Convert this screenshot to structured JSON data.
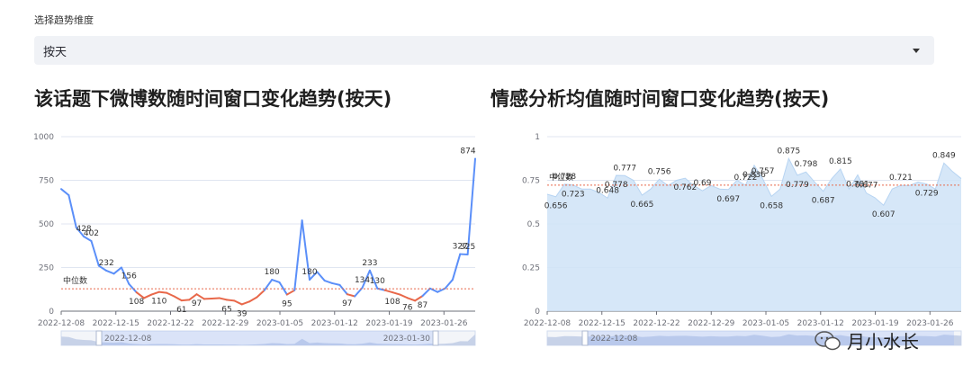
{
  "selector": {
    "label": "选择趋势维度",
    "value": "按天"
  },
  "watermark": "月小水长",
  "colors": {
    "blue": "#5b8ff9",
    "red": "#e8684a",
    "area": "#cfe3f7",
    "median": "#e8684a"
  },
  "chart_data": [
    {
      "type": "line",
      "title": "该话题下微博数随时间窗口变化趋势(按天)",
      "xlabel": "",
      "ylabel": "",
      "ylim": [
        0,
        1000
      ],
      "yticks": [
        "0",
        "250",
        "500",
        "750",
        "1000"
      ],
      "xticks": [
        "2022-12-08",
        "2022-12-15",
        "2022-12-22",
        "2022-12-29",
        "2023-01-05",
        "2023-01-12",
        "2023-01-19",
        "2023-01-26"
      ],
      "median_label": "中位数",
      "median": 128,
      "dataZoom": {
        "start": "2022-12-08",
        "end": "2023-01-30"
      },
      "x": [
        "2022-12-08",
        "2022-12-09",
        "2022-12-10",
        "2022-12-11",
        "2022-12-12",
        "2022-12-13",
        "2022-12-14",
        "2022-12-15",
        "2022-12-16",
        "2022-12-17",
        "2022-12-18",
        "2022-12-19",
        "2022-12-20",
        "2022-12-21",
        "2022-12-22",
        "2022-12-23",
        "2022-12-24",
        "2022-12-25",
        "2022-12-26",
        "2022-12-27",
        "2022-12-28",
        "2022-12-29",
        "2022-12-30",
        "2022-12-31",
        "2023-01-01",
        "2023-01-02",
        "2023-01-03",
        "2023-01-04",
        "2023-01-05",
        "2023-01-06",
        "2023-01-07",
        "2023-01-08",
        "2023-01-09",
        "2023-01-10",
        "2023-01-11",
        "2023-01-12",
        "2023-01-13",
        "2023-01-14",
        "2023-01-15",
        "2023-01-16",
        "2023-01-17",
        "2023-01-18",
        "2023-01-19",
        "2023-01-20",
        "2023-01-21",
        "2023-01-22",
        "2023-01-23",
        "2023-01-24",
        "2023-01-25",
        "2023-01-26",
        "2023-01-27",
        "2023-01-28",
        "2023-01-29",
        "2023-01-30"
      ],
      "values": [
        700,
        665,
        480,
        428,
        402,
        260,
        232,
        215,
        250,
        156,
        108,
        75,
        95,
        110,
        105,
        85,
        61,
        65,
        97,
        70,
        72,
        75,
        65,
        60,
        39,
        55,
        80,
        120,
        180,
        165,
        95,
        120,
        520,
        180,
        225,
        175,
        160,
        150,
        97,
        85,
        134,
        233,
        130,
        120,
        108,
        95,
        76,
        60,
        87,
        130,
        110,
        130,
        180,
        327,
        325,
        874
      ],
      "label_points": [
        [
          3,
          "428"
        ],
        [
          4,
          "402"
        ],
        [
          6,
          "232"
        ],
        [
          9,
          "156"
        ],
        [
          10,
          "108"
        ],
        [
          13,
          "110"
        ],
        [
          16,
          "61"
        ],
        [
          18,
          "97"
        ],
        [
          22,
          "65"
        ],
        [
          24,
          "39"
        ],
        [
          28,
          "180"
        ],
        [
          30,
          "95"
        ],
        [
          33,
          "180"
        ],
        [
          38,
          "97"
        ],
        [
          40,
          "134"
        ],
        [
          41,
          "233"
        ],
        [
          42,
          "130"
        ],
        [
          44,
          "108"
        ],
        [
          46,
          "76"
        ],
        [
          48,
          "87"
        ],
        [
          53,
          "327"
        ],
        [
          54,
          "325"
        ],
        [
          55,
          "874"
        ]
      ]
    },
    {
      "type": "area",
      "title": "情感分析均值随时间窗口变化趋势(按天)",
      "xlabel": "",
      "ylabel": "",
      "ylim": [
        0,
        1
      ],
      "yticks": [
        "0",
        "0.25",
        "0.5",
        "0.75",
        "1"
      ],
      "xticks": [
        "2022-12-08",
        "2022-12-15",
        "2022-12-22",
        "2022-12-29",
        "2023-01-05",
        "2023-01-12",
        "2023-01-19",
        "2023-01-26"
      ],
      "median_label": "中位数",
      "median": 0.722,
      "dataZoom": {
        "start": "2022-12-08",
        "end": ""
      },
      "values": [
        0.67,
        0.656,
        0.728,
        0.723,
        0.7,
        0.7,
        0.68,
        0.648,
        0.778,
        0.777,
        0.75,
        0.665,
        0.7,
        0.756,
        0.72,
        0.75,
        0.762,
        0.72,
        0.69,
        0.72,
        0.7,
        0.697,
        0.75,
        0.722,
        0.836,
        0.757,
        0.658,
        0.7,
        0.875,
        0.779,
        0.798,
        0.74,
        0.687,
        0.76,
        0.815,
        0.7,
        0.781,
        0.677,
        0.65,
        0.607,
        0.7,
        0.721,
        0.72,
        0.74,
        0.729,
        0.7,
        0.849,
        0.8,
        0.76
      ],
      "label_points": [
        [
          1,
          "0.656"
        ],
        [
          2,
          "0.728"
        ],
        [
          3,
          "0.723"
        ],
        [
          7,
          "0.648"
        ],
        [
          8,
          "0.778"
        ],
        [
          9,
          "0.777"
        ],
        [
          11,
          "0.665"
        ],
        [
          13,
          "0.756"
        ],
        [
          16,
          "0.762"
        ],
        [
          18,
          "0.69"
        ],
        [
          21,
          "0.697"
        ],
        [
          23,
          "0.722"
        ],
        [
          24,
          "0.836"
        ],
        [
          25,
          "0.757"
        ],
        [
          26,
          "0.658"
        ],
        [
          28,
          "0.875"
        ],
        [
          29,
          "0.779"
        ],
        [
          30,
          "0.798"
        ],
        [
          32,
          "0.687"
        ],
        [
          34,
          "0.815"
        ],
        [
          36,
          "0.781"
        ],
        [
          37,
          "0.677"
        ],
        [
          39,
          "0.607"
        ],
        [
          41,
          "0.721"
        ],
        [
          44,
          "0.729"
        ],
        [
          46,
          "0.849"
        ]
      ]
    }
  ]
}
